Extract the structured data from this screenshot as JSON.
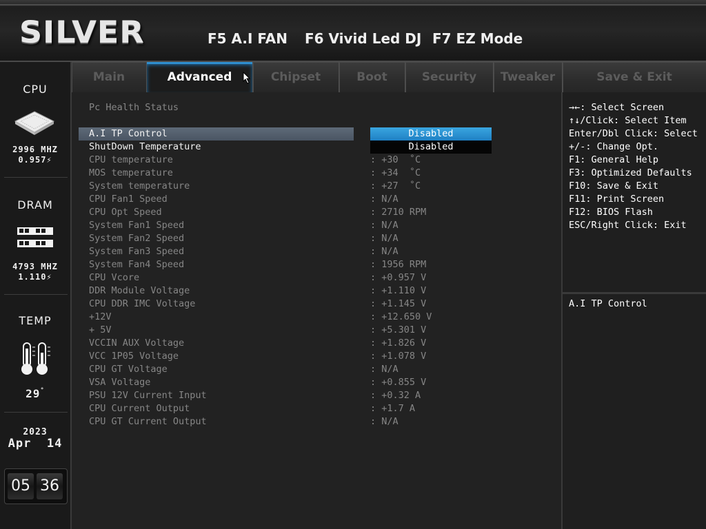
{
  "header": {
    "logo": "SILVER",
    "hotkeys": [
      "F5 A.I FAN",
      "F6 Vivid Led DJ",
      "F7 EZ Mode"
    ]
  },
  "sidebar": {
    "cpu": {
      "title": "CPU",
      "freq": "2996 MHZ",
      "volt": "0.957"
    },
    "dram": {
      "title": "DRAM",
      "freq": "4793 MHZ",
      "volt": "1.110"
    },
    "temp": {
      "title": "TEMP",
      "value": "29"
    },
    "date": {
      "year": "2023",
      "day": "Apr  14"
    },
    "clock": {
      "hour": "05",
      "minute": "36"
    }
  },
  "tabs": [
    "Main",
    "Advanced",
    "Chipset",
    "Boot",
    "Security",
    "Tweaker",
    "Save & Exit"
  ],
  "active_tab": "Advanced",
  "main": {
    "section_title": "Pc Health Status",
    "options": [
      {
        "label": "A.I TP Control",
        "value": "Disabled"
      },
      {
        "label": "ShutDown Temperature",
        "value": "Disabled"
      }
    ],
    "rows": [
      {
        "label": "CPU temperature",
        "value": ": +30  ˚C"
      },
      {
        "label": "MOS temperature",
        "value": ": +34  ˚C"
      },
      {
        "label": "System temperature",
        "value": ": +27  ˚C"
      },
      {
        "label": "CPU Fan1 Speed",
        "value": ": N/A"
      },
      {
        "label": "CPU Opt Speed",
        "value": ": 2710 RPM"
      },
      {
        "label": "System Fan1 Speed",
        "value": ": N/A"
      },
      {
        "label": "System Fan2 Speed",
        "value": ": N/A"
      },
      {
        "label": "System Fan3 Speed",
        "value": ": N/A"
      },
      {
        "label": "System Fan4 Speed",
        "value": ": 1956 RPM"
      },
      {
        "label": "CPU Vcore",
        "value": ": +0.957 V"
      },
      {
        "label": "DDR Module Voltage",
        "value": ": +1.110 V"
      },
      {
        "label": "CPU DDR IMC Voltage",
        "value": ": +1.145 V"
      },
      {
        "label": "+12V",
        "value": ": +12.650 V"
      },
      {
        "label": "+ 5V",
        "value": ": +5.301 V"
      },
      {
        "label": "VCCIN AUX Voltage",
        "value": ": +1.826 V"
      },
      {
        "label": "VCC 1P05 Voltage",
        "value": ": +1.078 V"
      },
      {
        "label": "CPU GT Voltage",
        "value": ": N/A"
      },
      {
        "label": "VSA Voltage",
        "value": ": +0.855 V"
      },
      {
        "label": "PSU 12V Current Input",
        "value": ": +0.32 A"
      },
      {
        "label": "CPU Current Output",
        "value": ": +1.7 A"
      },
      {
        "label": "CPU GT Current Output",
        "value": ": N/A"
      }
    ]
  },
  "help": {
    "keys": [
      "→←: Select Screen",
      "↑↓/Click: Select Item",
      "Enter/Dbl Click: Select",
      "+/-: Change Opt.",
      "F1: General Help",
      "F3: Optimized Defaults",
      "F10: Save & Exit",
      "F11: Print Screen",
      "F12: BIOS Flash",
      "ESC/Right Click: Exit"
    ],
    "description": "A.I TP Control"
  },
  "colors": {
    "accent": "#2f8fcf",
    "selection_bar": "#5a6676",
    "option_highlight": "#2a90d0",
    "text_dim": "#868686",
    "text_bright": "#f2f2f2"
  }
}
